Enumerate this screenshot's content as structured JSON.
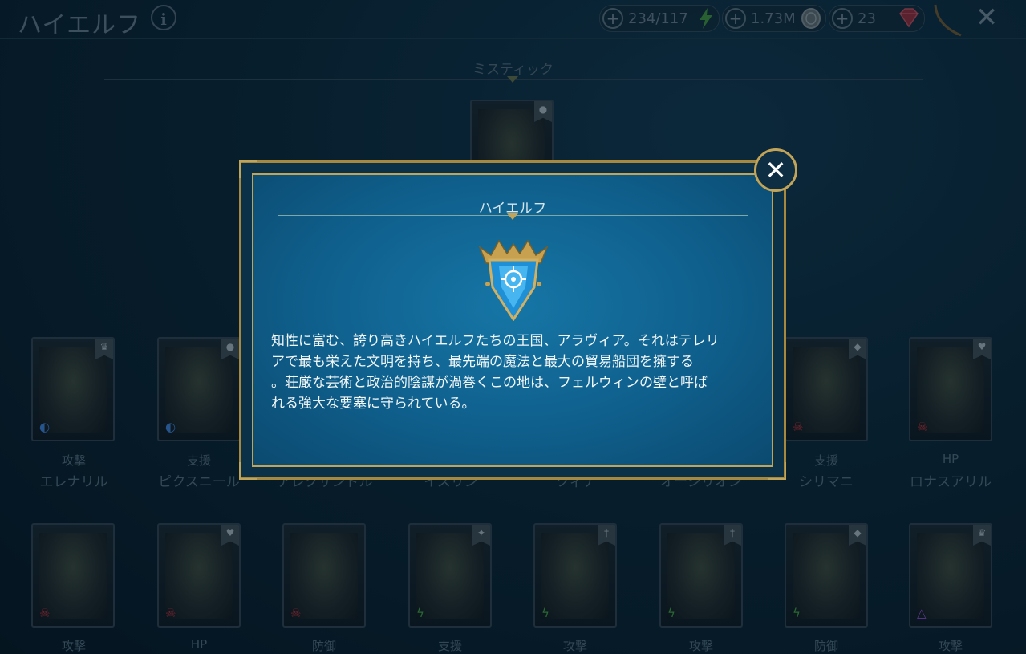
{
  "header": {
    "title": "ハイエルフ",
    "info_icon": "info-icon",
    "energy": "234/117",
    "silver": "1.73M",
    "gems": "23"
  },
  "section": {
    "label": "ミスティック"
  },
  "row1": [
    {
      "role": "攻撃",
      "name": "エレナリル"
    },
    {
      "role": "支援",
      "name": "ピクスニール"
    },
    {
      "role": "",
      "name": "アレクサンドル"
    },
    {
      "role": "",
      "name": "イスリン"
    },
    {
      "role": "",
      "name": "ツィナ"
    },
    {
      "role": "",
      "name": "オーシリオン"
    },
    {
      "role": "支援",
      "name": "シリマニ"
    },
    {
      "role": "HP",
      "name": "ロナスアリル"
    }
  ],
  "row2": [
    {
      "role": "攻撃"
    },
    {
      "role": "HP"
    },
    {
      "role": "防御"
    },
    {
      "role": "支援"
    },
    {
      "role": "攻撃"
    },
    {
      "role": "攻撃"
    },
    {
      "role": "防御"
    },
    {
      "role": "攻撃"
    }
  ],
  "modal": {
    "title": "ハイエルフ",
    "body_lines": [
      "知性に富む、誇り高きハイエルフたちの王国、アラヴィア。それはテレリ",
      "アで最も栄えた文明を持ち、最先端の魔法と最大の貿易船団を擁する",
      "。荘厳な芸術と政治的陰謀が渦巻くこの地は、フェルウィンの壁と呼ば",
      "れる強大な要塞に守られている。"
    ],
    "close_icon": "close-icon"
  },
  "colors": {
    "gold": "#c2a458",
    "panel": "#0f5f8c",
    "bg": "#0c2a3c"
  }
}
